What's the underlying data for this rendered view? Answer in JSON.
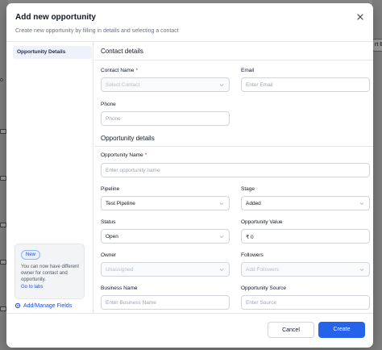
{
  "background": {
    "left_text": "o",
    "right_chip": "rt B"
  },
  "modal": {
    "title": "Add new opportunity",
    "subtitle": "Create new opportunity by filling in details and selecting a contact"
  },
  "sidebar": {
    "active_item": "Opportunity Details",
    "promo": {
      "badge": "New",
      "text": "You can now have different owner for contact and opportunity.",
      "link": "Go to labs"
    },
    "manage_fields": "Add/Manage Fields"
  },
  "contact_details": {
    "heading": "Contact details",
    "contact_name_label": "Contact Name",
    "contact_name_placeholder": "Select Contact",
    "email_label": "Email",
    "email_placeholder": "Enter Email",
    "phone_label": "Phone",
    "phone_placeholder": "Phone"
  },
  "opportunity_details": {
    "heading": "Opportunity details",
    "name_label": "Opportunity Name",
    "name_placeholder": "Enter opportunity name",
    "pipeline_label": "Pipeline",
    "pipeline_value": "Test Pipeline",
    "stage_label": "Stage",
    "stage_value": "Added",
    "status_label": "Status",
    "status_value": "Open",
    "value_label": "Opportunity Value",
    "value_value": "₹ 0",
    "owner_label": "Owner",
    "owner_placeholder": "Unassigned",
    "followers_label": "Followers",
    "followers_placeholder": "Add Followers",
    "business_label": "Business Name",
    "business_placeholder": "Enter Business Name",
    "source_label": "Opportunity Source",
    "source_placeholder": "Enter Source"
  },
  "required_marker": "*",
  "footer": {
    "cancel": "Cancel",
    "create": "Create"
  },
  "colors": {
    "primary": "#2563eb",
    "required": "#dc2626",
    "link": "#1d4ed8"
  }
}
